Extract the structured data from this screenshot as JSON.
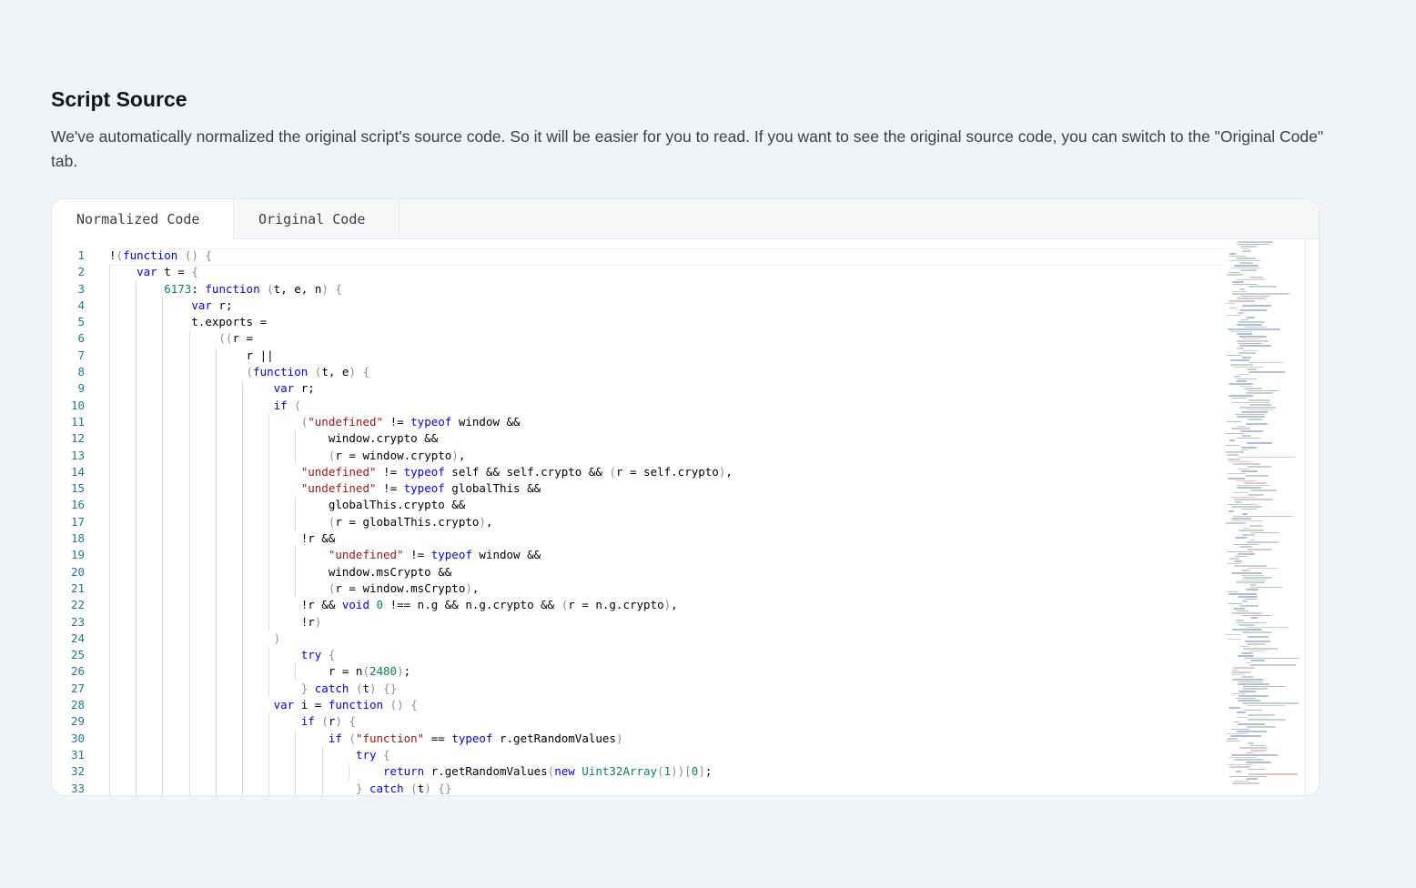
{
  "section": {
    "title": "Script Source",
    "description": "We've automatically normalized the original script's source code. So it will be easier for you to read. If you want to see the original source code, you can switch to the \"Original Code\" tab."
  },
  "tabs": [
    {
      "label": "Normalized Code",
      "active": true
    },
    {
      "label": "Original Code",
      "active": false
    }
  ],
  "code_lines": [
    "!(function () {",
    "  var t = {",
    "    6173: function (t, e, n) {",
    "      var r;",
    "      t.exports =",
    "        ((r =",
    "          r ||",
    "          (function (t, e) {",
    "            var r;",
    "            if (",
    "              (\"undefined\" != typeof window &&",
    "                window.crypto &&",
    "                (r = window.crypto),",
    "              \"undefined\" != typeof self && self.crypto && (r = self.crypto),",
    "              \"undefined\" != typeof globalThis &&",
    "                globalThis.crypto &&",
    "                (r = globalThis.crypto),",
    "              !r &&",
    "                \"undefined\" != typeof window &&",
    "                window.msCrypto &&",
    "                (r = window.msCrypto),",
    "              !r && void 0 !== n.g && n.g.crypto && (r = n.g.crypto),",
    "              !r)",
    "            )",
    "              try {",
    "                r = n(2480);",
    "              } catch (t) {}",
    "            var i = function () {",
    "              if (r) {",
    "                if (\"function\" == typeof r.getRandomValues)",
    "                  try {",
    "                    return r.getRandomValues(new Uint32Array(1))[0];",
    "                  } catch (t) {}"
  ]
}
